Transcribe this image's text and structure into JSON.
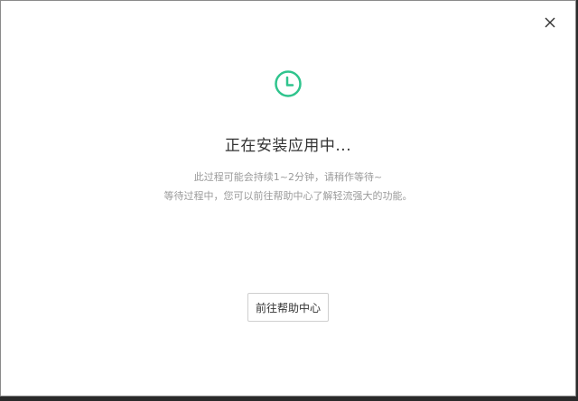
{
  "dialog": {
    "title": "正在安装应用中...",
    "description_line1": "此过程可能会持续1~2分钟，请稍作等待~",
    "description_line2": "等待过程中，您可以前往帮助中心了解轻流强大的功能。",
    "help_button_label": "前往帮助中心",
    "close_icon": "close-icon",
    "status_icon": "clock-icon",
    "accent_color": "#2fc48d"
  }
}
